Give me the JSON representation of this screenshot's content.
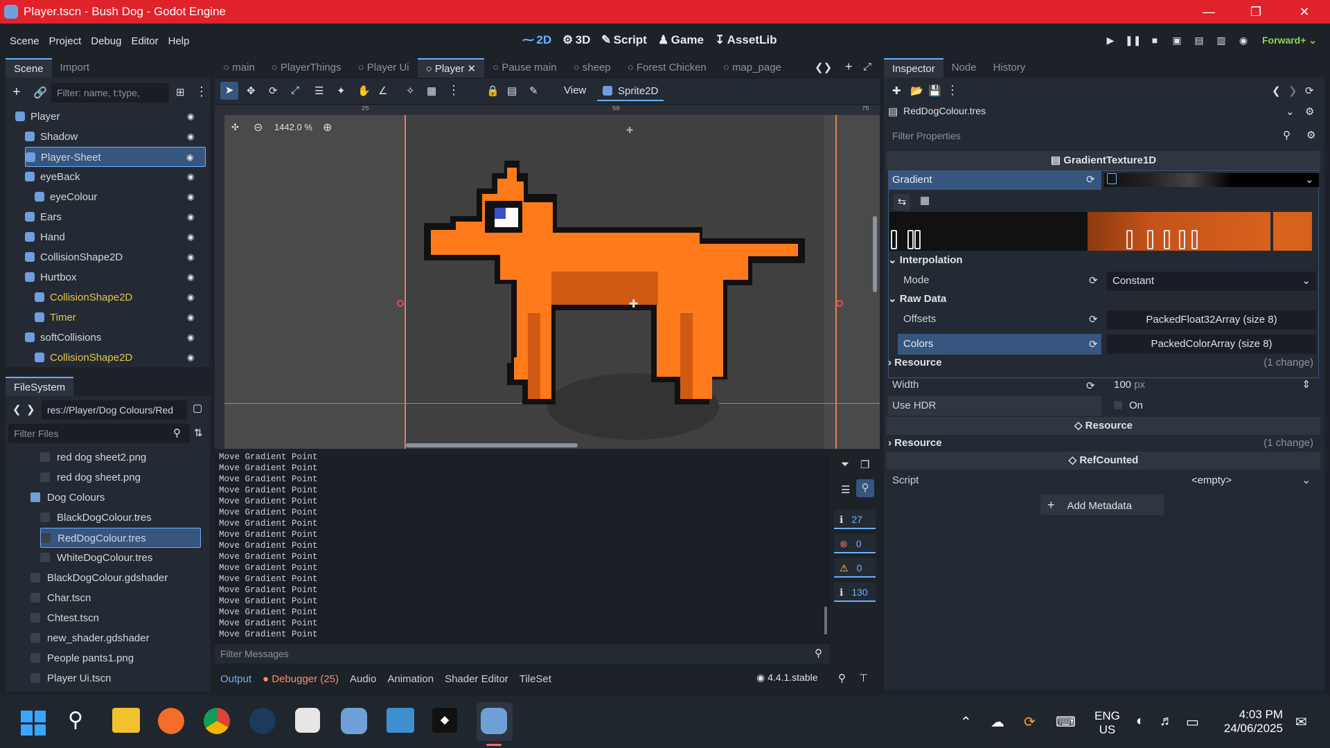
{
  "window": {
    "title": "Player.tscn - Bush Dog - Godot Engine"
  },
  "menus": [
    "Scene",
    "Project",
    "Debug",
    "Editor",
    "Help"
  ],
  "workspaces": [
    "2D",
    "3D",
    "Script",
    "Game",
    "AssetLib"
  ],
  "renderer": "Forward+",
  "scene_panel": {
    "tabs": [
      "Scene",
      "Import"
    ],
    "filter_placeholder": "Filter: name, t:type,",
    "nodes": [
      {
        "label": "Player",
        "depth": 0,
        "color": "#d3d7dc"
      },
      {
        "label": "Shadow",
        "depth": 1,
        "color": "#d3d7dc"
      },
      {
        "label": "Player-Sheet",
        "depth": 1,
        "color": "#d3d7dc",
        "selected": true
      },
      {
        "label": "eyeBack",
        "depth": 1,
        "color": "#d3d7dc"
      },
      {
        "label": "eyeColour",
        "depth": 2,
        "color": "#d3d7dc"
      },
      {
        "label": "Ears",
        "depth": 1,
        "color": "#d3d7dc"
      },
      {
        "label": "Hand",
        "depth": 1,
        "color": "#d3d7dc"
      },
      {
        "label": "CollisionShape2D",
        "depth": 1,
        "color": "#d3d7dc"
      },
      {
        "label": "Hurtbox",
        "depth": 1,
        "color": "#d3d7dc"
      },
      {
        "label": "CollisionShape2D",
        "depth": 2,
        "color": "#e7c54a"
      },
      {
        "label": "Timer",
        "depth": 2,
        "color": "#e7c54a"
      },
      {
        "label": "softCollisions",
        "depth": 1,
        "color": "#d3d7dc"
      },
      {
        "label": "CollisionShape2D",
        "depth": 2,
        "color": "#e7c54a"
      }
    ]
  },
  "filesystem": {
    "tab": "FileSystem",
    "path": "res://Player/Dog Colours/Red",
    "filter_placeholder": "Filter Files",
    "items": [
      {
        "label": "red dog sheet2.png",
        "indent": 3
      },
      {
        "label": "red dog sheet.png",
        "indent": 3
      },
      {
        "label": "Dog Colours",
        "indent": 2,
        "folder": true
      },
      {
        "label": "BlackDogColour.tres",
        "indent": 3
      },
      {
        "label": "RedDogColour.tres",
        "indent": 3,
        "selected": true
      },
      {
        "label": "WhiteDogColour.tres",
        "indent": 3
      },
      {
        "label": "BlackDogColour.gdshader",
        "indent": 2
      },
      {
        "label": "Char.tscn",
        "indent": 2
      },
      {
        "label": "Chtest.tscn",
        "indent": 2
      },
      {
        "label": "new_shader.gdshader",
        "indent": 2
      },
      {
        "label": "People pants1.png",
        "indent": 2
      },
      {
        "label": "Player Ui.tscn",
        "indent": 2
      }
    ]
  },
  "scene_tabs": [
    "main",
    "PlayerThings",
    "Player Ui",
    "Player",
    "Pause main",
    "sheep",
    "Forest Chicken",
    "map_page"
  ],
  "viewport": {
    "view_label": "View",
    "node_button": "Sprite2D",
    "zoom": "1442.0 %",
    "ruler_ticks": [
      "25",
      "50",
      "75"
    ]
  },
  "output": {
    "line": "Move Gradient Point",
    "line_count": 17,
    "filter_placeholder": "Filter Messages",
    "counts": [
      "27",
      "0",
      "0",
      "130"
    ],
    "bottom_tabs": [
      "Output",
      "Debugger (25)",
      "Audio",
      "Animation",
      "Shader Editor",
      "TileSet"
    ],
    "version": "4.4.1.stable"
  },
  "inspector": {
    "tabs": [
      "Inspector",
      "Node",
      "History"
    ],
    "resource_file": "RedDogColour.tres",
    "filter_placeholder": "Filter Properties",
    "class_title": "GradientTexture1D",
    "gradient_label": "Gradient",
    "interpolation": "Interpolation",
    "mode_label": "Mode",
    "mode_value": "Constant",
    "raw_data": "Raw Data",
    "offsets_label": "Offsets",
    "offsets_value": "PackedFloat32Array (size 8)",
    "colors_label": "Colors",
    "colors_value": "PackedColorArray (size 8)",
    "resource_label": "Resource",
    "change": "(1 change)",
    "width_label": "Width",
    "width_value": "100",
    "width_unit": "px",
    "hdr_label": "Use HDR",
    "hdr_value": "On",
    "resource_header": "Resource",
    "resource_row": "Resource",
    "resource_change": "(1 change)",
    "refcounted": "RefCounted",
    "script_label": "Script",
    "script_value": "<empty>",
    "add_metadata": "Add Metadata"
  },
  "taskbar": {
    "lang1": "ENG",
    "lang2": "US",
    "time": "4:03 PM",
    "date": "24/06/2025"
  },
  "colors": {
    "accent": "#6ab0ff",
    "titlebar": "#e0222b",
    "dog": "#ff7a1a",
    "selection": "#36567f"
  }
}
